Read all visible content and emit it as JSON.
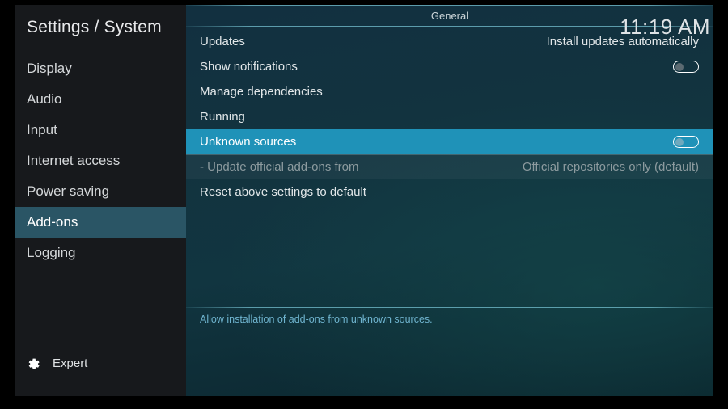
{
  "window": {
    "title": "Settings / System",
    "clock": "11:19 AM"
  },
  "sidebar": {
    "items": [
      {
        "label": "Display",
        "selected": false
      },
      {
        "label": "Audio",
        "selected": false
      },
      {
        "label": "Input",
        "selected": false
      },
      {
        "label": "Internet access",
        "selected": false
      },
      {
        "label": "Power saving",
        "selected": false
      },
      {
        "label": "Add-ons",
        "selected": true
      },
      {
        "label": "Logging",
        "selected": false
      }
    ],
    "expert": {
      "label": "Expert",
      "icon": "gear-icon"
    }
  },
  "main": {
    "category": "General",
    "rows": [
      {
        "label": "Updates",
        "value": "Install updates automatically",
        "control": "text",
        "state": "normal"
      },
      {
        "label": "Show notifications",
        "value": "",
        "control": "toggle",
        "toggle_on": false,
        "state": "normal"
      },
      {
        "label": "Manage dependencies",
        "value": "",
        "control": "none",
        "state": "normal"
      },
      {
        "label": "Running",
        "value": "",
        "control": "none",
        "state": "normal"
      },
      {
        "label": "Unknown sources",
        "value": "",
        "control": "toggle",
        "toggle_on": false,
        "state": "selected"
      },
      {
        "label": "- Update official add-ons from",
        "value": "Official repositories only (default)",
        "control": "text",
        "state": "disabled"
      },
      {
        "label": "Reset above settings to default",
        "value": "",
        "control": "none",
        "state": "normal"
      }
    ],
    "help_text": "Allow installation of add-ons from unknown sources."
  },
  "colors": {
    "selection_teal": "#1f92b8",
    "sidebar_selection": "#2a5565",
    "help_text": "#6fb4cf",
    "sidebar_bg": "#17191c"
  }
}
